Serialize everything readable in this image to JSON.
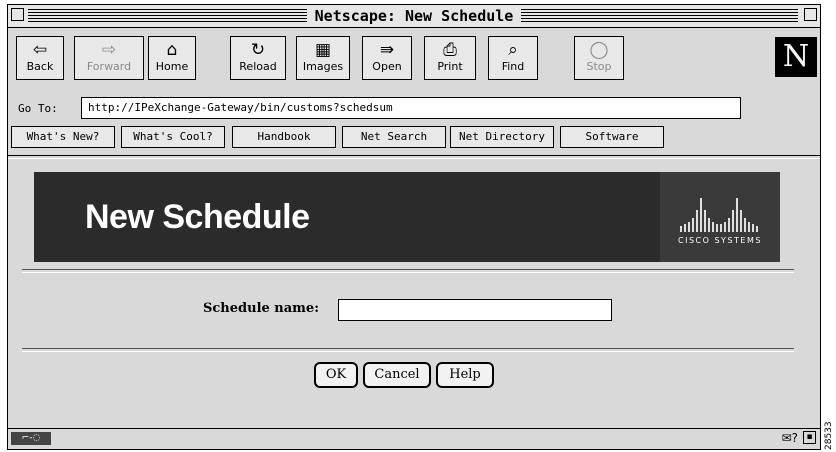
{
  "window": {
    "title": "Netscape: New Schedule"
  },
  "toolbar": {
    "buttons": [
      {
        "label": "Back",
        "icon": "back-arrow-icon",
        "glyph": "⇦",
        "enabled": true
      },
      {
        "label": "Forward",
        "icon": "forward-arrow-icon",
        "glyph": "⇨",
        "enabled": false
      },
      {
        "label": "Home",
        "icon": "home-icon",
        "glyph": "⌂",
        "enabled": true
      },
      {
        "label": "Reload",
        "icon": "reload-icon",
        "glyph": "↻",
        "enabled": true
      },
      {
        "label": "Images",
        "icon": "images-icon",
        "glyph": "▦",
        "enabled": true
      },
      {
        "label": "Open",
        "icon": "open-icon",
        "glyph": "⇛",
        "enabled": true
      },
      {
        "label": "Print",
        "icon": "print-icon",
        "glyph": "⎙",
        "enabled": true
      },
      {
        "label": "Find",
        "icon": "find-icon",
        "glyph": "⌕",
        "enabled": true
      },
      {
        "label": "Stop",
        "icon": "stop-icon",
        "glyph": "◯",
        "enabled": false
      }
    ],
    "logo": "N"
  },
  "location": {
    "label": "Go To:",
    "url": "http://IPeXchange-Gateway/bin/customs?schedsum"
  },
  "directory": {
    "buttons": [
      "What's New?",
      "What's Cool?",
      "Handbook",
      "Net Search",
      "Net Directory",
      "Software"
    ]
  },
  "banner": {
    "title": "New Schedule",
    "brand": "CISCO SYSTEMS"
  },
  "form": {
    "schedule_label": "Schedule name:",
    "schedule_value": "",
    "ok": "OK",
    "cancel": "Cancel",
    "help": "Help"
  },
  "status": {
    "security": "⌐-◌"
  },
  "figure_code": "28533"
}
